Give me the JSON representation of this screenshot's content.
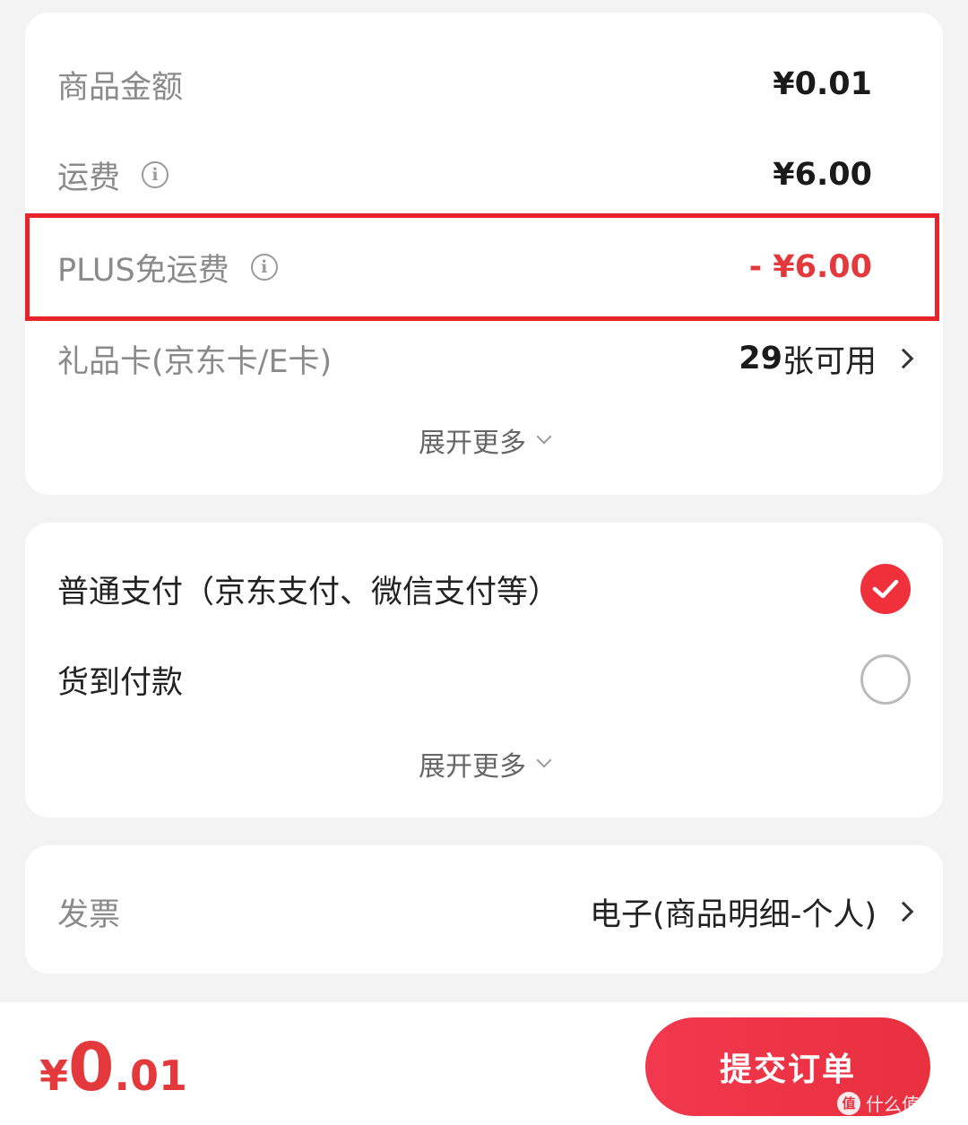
{
  "summary": {
    "goods_amount": {
      "label": "商品金额",
      "value": "¥0.01"
    },
    "shipping": {
      "label": "运费",
      "value": "¥6.00"
    },
    "plus_free_shipping": {
      "label": "PLUS免运费",
      "value": "- ¥6.00"
    },
    "gift_card": {
      "label": "礼品卡(京东卡/E卡)",
      "count": "29",
      "suffix": "张可用"
    },
    "expand_label": "展开更多"
  },
  "payment": {
    "normal": {
      "label": "普通支付（京东支付、微信支付等）",
      "selected": true
    },
    "cod": {
      "label": "货到付款",
      "selected": false
    },
    "expand_label": "展开更多"
  },
  "invoice": {
    "label": "发票",
    "value": "电子(商品明细-个人)"
  },
  "footer": {
    "total_currency": "¥",
    "total_int": "0",
    "total_dec": ".01",
    "submit_label": "提交订单",
    "watermark_logo": "值",
    "watermark_text": "什么值得买"
  },
  "colors": {
    "accent_red": "#e4393c",
    "highlight_border": "#e8232a",
    "background": "#f3f3f3"
  },
  "icons": [
    "info-icon",
    "chevron-right-icon",
    "chevron-down-icon",
    "check-icon",
    "radio-empty-icon"
  ]
}
